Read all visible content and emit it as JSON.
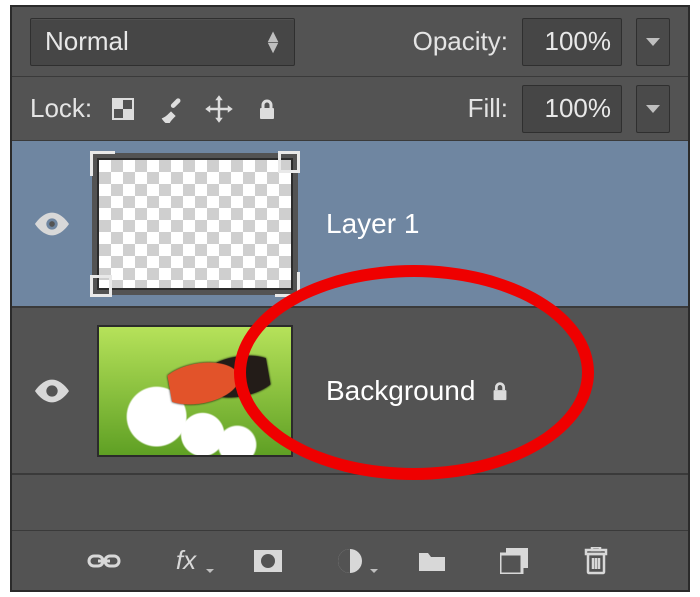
{
  "blend_mode": {
    "value": "Normal"
  },
  "opacity": {
    "label": "Opacity:",
    "value": "100%"
  },
  "lock_row": {
    "label": "Lock:"
  },
  "fill": {
    "label": "Fill:",
    "value": "100%"
  },
  "layers": [
    {
      "name": "Layer 1",
      "selected": true,
      "locked": false,
      "visible": true,
      "thumb": "transparent"
    },
    {
      "name": "Background",
      "selected": false,
      "locked": true,
      "visible": true,
      "thumb": "flower"
    }
  ],
  "footer_tools": [
    "link-layers",
    "layer-fx",
    "layer-mask",
    "adjustment-layer",
    "layer-group",
    "new-layer",
    "delete-layer"
  ]
}
